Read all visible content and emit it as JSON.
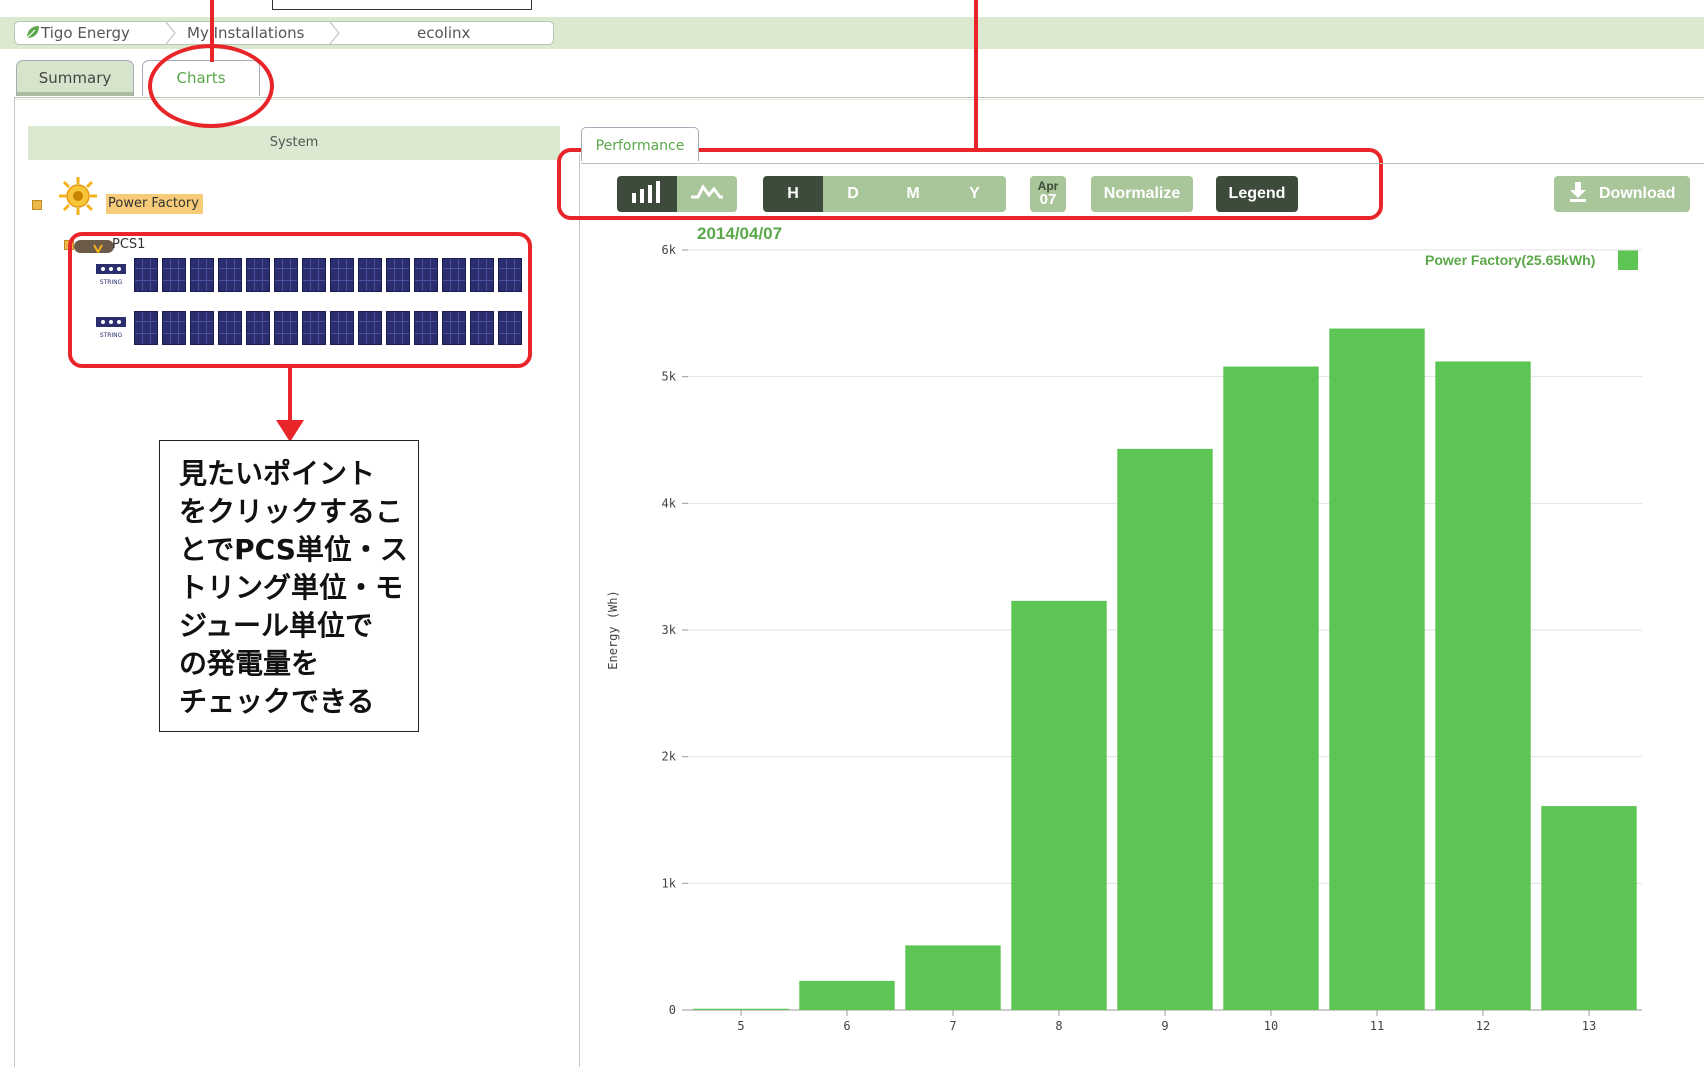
{
  "breadcrumb": {
    "items": [
      "Tigo Energy",
      "My Installations",
      "ecolinx"
    ]
  },
  "tabs": {
    "summary": "Summary",
    "charts": "Charts"
  },
  "sidebar": {
    "header": "System",
    "tree": {
      "root": "Power Factory",
      "pcs": "PCS1",
      "string_label": "STRING",
      "strings": [
        {
          "panels": 14
        },
        {
          "panels": 14
        }
      ]
    }
  },
  "annotation": {
    "lines": [
      "見たいポイント",
      "をクリックするこ",
      "とでPCS単位・ス",
      "トリング単位・モ",
      "ジュール単位で",
      "の発電量を",
      "チェックできる"
    ]
  },
  "performance_tab": "Performance",
  "toolbar": {
    "period_buttons": [
      "H",
      "D",
      "M",
      "Y"
    ],
    "active_period": "H",
    "date_month": "Apr",
    "date_day": "07",
    "normalize": "Normalize",
    "legend": "Legend",
    "download": "Download"
  },
  "chart_data": {
    "type": "bar",
    "title": "2014/04/07",
    "ylabel": "Energy (Wh)",
    "xlabel": "",
    "categories": [
      "5",
      "6",
      "7",
      "8",
      "9",
      "10",
      "11",
      "12",
      "13"
    ],
    "series": [
      {
        "name": "Power Factory(25.65kWh)",
        "color": "#5dc553",
        "values": [
          10,
          230,
          510,
          3230,
          4430,
          5080,
          5380,
          5120,
          1610
        ]
      }
    ],
    "ylim": [
      0,
      6000
    ],
    "yticks": [
      "0",
      "1k",
      "2k",
      "3k",
      "4k",
      "5k",
      "6k"
    ],
    "grid": true,
    "legend_position": "top-right"
  },
  "colors": {
    "accent_green": "#5dc553",
    "dark_button": "#3d4b3a",
    "light_button": "#a9c59a",
    "annotation_red": "#e8262a"
  }
}
